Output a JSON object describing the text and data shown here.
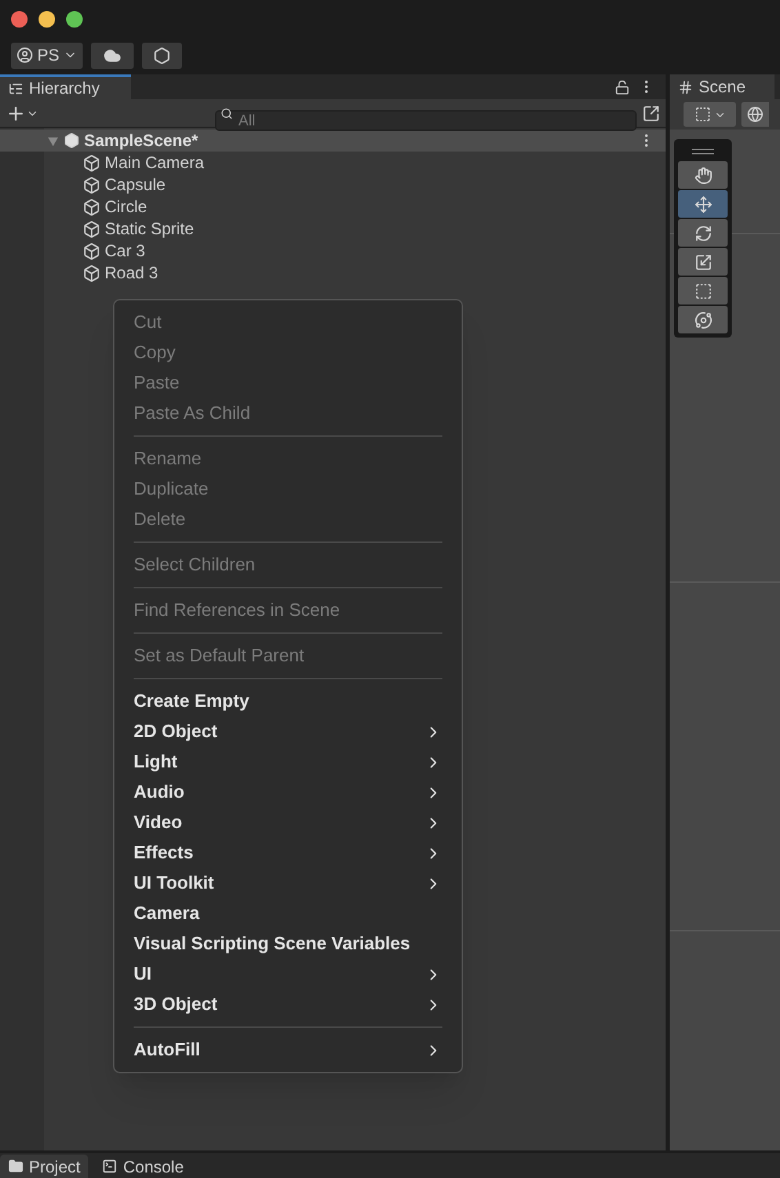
{
  "toolbar": {
    "account": "PS"
  },
  "hierarchy": {
    "tab": "Hierarchy",
    "search": {
      "placeholder": "All"
    },
    "scene": {
      "name": "SampleScene*",
      "expanded": true,
      "children": [
        {
          "name": "Main Camera"
        },
        {
          "name": "Capsule"
        },
        {
          "name": "Circle"
        },
        {
          "name": "Static Sprite"
        },
        {
          "name": "Car 3"
        },
        {
          "name": "Road 3"
        }
      ]
    }
  },
  "context_menu": [
    {
      "kind": "item",
      "label": "Cut",
      "disabled": true,
      "submenu": false
    },
    {
      "kind": "item",
      "label": "Copy",
      "disabled": true,
      "submenu": false
    },
    {
      "kind": "item",
      "label": "Paste",
      "disabled": true,
      "submenu": false
    },
    {
      "kind": "item",
      "label": "Paste As Child",
      "disabled": true,
      "submenu": false
    },
    {
      "kind": "separator"
    },
    {
      "kind": "item",
      "label": "Rename",
      "disabled": true,
      "submenu": false
    },
    {
      "kind": "item",
      "label": "Duplicate",
      "disabled": true,
      "submenu": false
    },
    {
      "kind": "item",
      "label": "Delete",
      "disabled": true,
      "submenu": false
    },
    {
      "kind": "separator"
    },
    {
      "kind": "item",
      "label": "Select Children",
      "disabled": true,
      "submenu": false
    },
    {
      "kind": "separator"
    },
    {
      "kind": "item",
      "label": "Find References in Scene",
      "disabled": true,
      "submenu": false
    },
    {
      "kind": "separator"
    },
    {
      "kind": "item",
      "label": "Set as Default Parent",
      "disabled": true,
      "submenu": false
    },
    {
      "kind": "separator"
    },
    {
      "kind": "item",
      "label": "Create Empty",
      "disabled": false,
      "submenu": false
    },
    {
      "kind": "item",
      "label": "2D Object",
      "disabled": false,
      "submenu": true
    },
    {
      "kind": "item",
      "label": "Light",
      "disabled": false,
      "submenu": true
    },
    {
      "kind": "item",
      "label": "Audio",
      "disabled": false,
      "submenu": true
    },
    {
      "kind": "item",
      "label": "Video",
      "disabled": false,
      "submenu": true
    },
    {
      "kind": "item",
      "label": "Effects",
      "disabled": false,
      "submenu": true
    },
    {
      "kind": "item",
      "label": "UI Toolkit",
      "disabled": false,
      "submenu": true
    },
    {
      "kind": "item",
      "label": "Camera",
      "disabled": false,
      "submenu": false
    },
    {
      "kind": "item",
      "label": "Visual Scripting Scene Variables",
      "disabled": false,
      "submenu": false
    },
    {
      "kind": "item",
      "label": "UI",
      "disabled": false,
      "submenu": true
    },
    {
      "kind": "item",
      "label": "3D Object",
      "disabled": false,
      "submenu": true
    },
    {
      "kind": "separator"
    },
    {
      "kind": "item",
      "label": "AutoFill",
      "disabled": false,
      "submenu": true
    }
  ],
  "scene_view": {
    "tab": "Scene",
    "tools": [
      {
        "kind": "hand",
        "selected": false
      },
      {
        "kind": "move",
        "selected": true
      },
      {
        "kind": "rotate",
        "selected": false
      },
      {
        "kind": "scale",
        "selected": false
      },
      {
        "kind": "rect",
        "selected": false
      },
      {
        "kind": "transform",
        "selected": false
      }
    ]
  },
  "bottom_tabs": [
    {
      "label": "Project",
      "selected": true
    },
    {
      "label": "Console",
      "selected": false
    }
  ]
}
